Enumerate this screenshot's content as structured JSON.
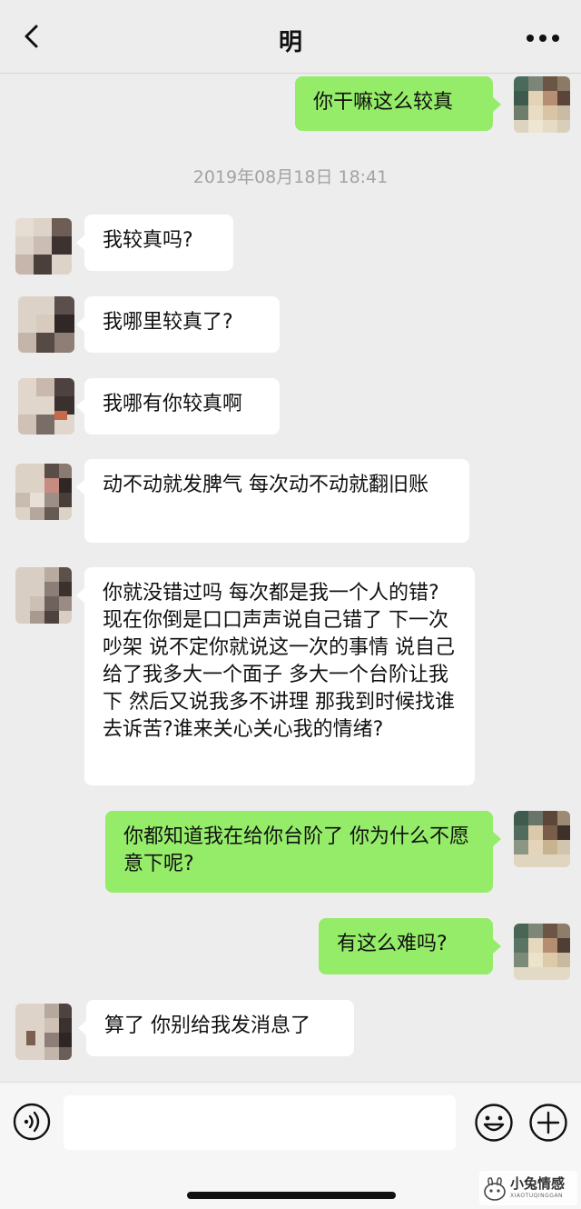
{
  "header": {
    "title": "明",
    "back_icon": "chevron-left-icon",
    "more_icon": "more-dots-icon"
  },
  "timestamp": "2019年08月18日 18:41",
  "messages": [
    {
      "side": "right",
      "text": "你干嘛这么较真"
    },
    {
      "side": "left",
      "text": "我较真吗?"
    },
    {
      "side": "left",
      "text": "我哪里较真了?"
    },
    {
      "side": "left",
      "text": "我哪有你较真啊"
    },
    {
      "side": "left",
      "text": "动不动就发脾气 每次动不动就翻旧账"
    },
    {
      "side": "left",
      "text": "你就没错过吗 每次都是我一个人的错? 现在你倒是口口声声说自己错了 下一次吵架 说不定你就说这一次的事情 说自己给了我多大一个面子 多大一个台阶让我下 然后又说我多不讲理 那我到时候找谁去诉苦?谁来关心关心我的情绪?"
    },
    {
      "side": "right",
      "text": "你都知道我在给你台阶了 你为什么不愿意下呢?"
    },
    {
      "side": "right",
      "text": "有这么难吗?"
    },
    {
      "side": "left",
      "text": "算了 你别给我发消息了"
    }
  ],
  "input_bar": {
    "voice_icon": "voice-icon",
    "input_value": "",
    "emoji_icon": "emoji-icon",
    "plus_icon": "plus-icon"
  },
  "watermark": {
    "text": "小兔情感",
    "sub": "XIAOTUQINGGAN"
  },
  "colors": {
    "background": "#ededed",
    "bubble_self": "#95ec69",
    "bubble_other": "#ffffff",
    "timestamp": "#a3a3a3"
  }
}
